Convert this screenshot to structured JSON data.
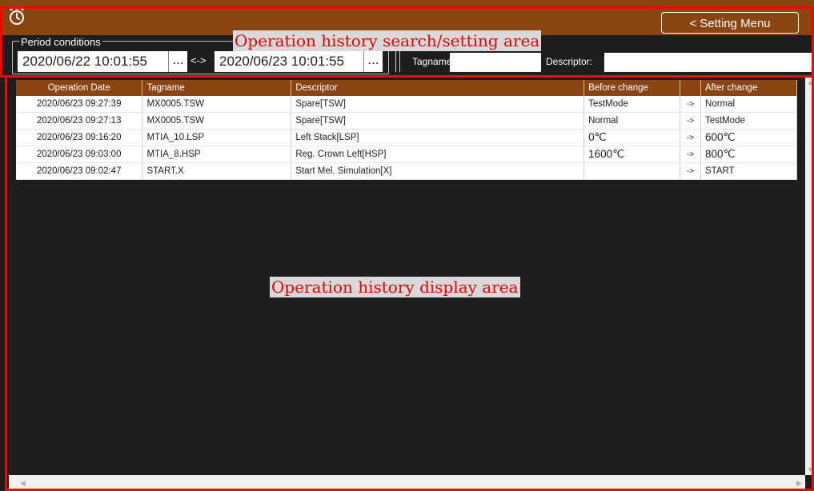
{
  "header": {
    "setting_menu_label": "< Setting Menu"
  },
  "search": {
    "period_legend": "Period conditions",
    "start_datetime": "2020/06/22 10:01:55",
    "end_datetime": "2020/06/23 10:01:55",
    "picker_label": "...",
    "range_sep": "<->",
    "tagname_label": "Tagname:",
    "tagname_value": "",
    "descriptor_label": "Descriptor:",
    "descriptor_value": ""
  },
  "annotations": {
    "search_area": "Operation history search/setting area",
    "display_area": "Operation history display area"
  },
  "table": {
    "columns": [
      "Operation Date",
      "Tagname",
      "Descriptor",
      "Before change",
      "",
      "After change"
    ],
    "rows": [
      [
        "2020/06/23 09:27:39",
        "MX0005.TSW",
        "Spare[TSW]",
        "TestMode",
        "->",
        "Normal"
      ],
      [
        "2020/06/23 09:27:13",
        "MX0005.TSW",
        "Spare[TSW]",
        "Normal",
        "->",
        "TestMode"
      ],
      [
        "2020/06/23 09:16:20",
        "MTIA_10.LSP",
        "Left Stack[LSP]",
        "0℃",
        "->",
        "600℃"
      ],
      [
        "2020/06/23 09:03:00",
        "MTIA_8.HSP",
        "Reg. Crown Left[HSP]",
        "1600℃",
        "->",
        "800℃"
      ],
      [
        "2020/06/23 09:02:47",
        "START.X",
        "Start Mel. Simulation[X]",
        "",
        "->",
        "START"
      ]
    ]
  },
  "icons": {
    "app": "alarm-clock-icon"
  },
  "colors": {
    "accent": "#8b4513",
    "background": "#1e1e1e",
    "annotation_red": "#ff0000"
  }
}
